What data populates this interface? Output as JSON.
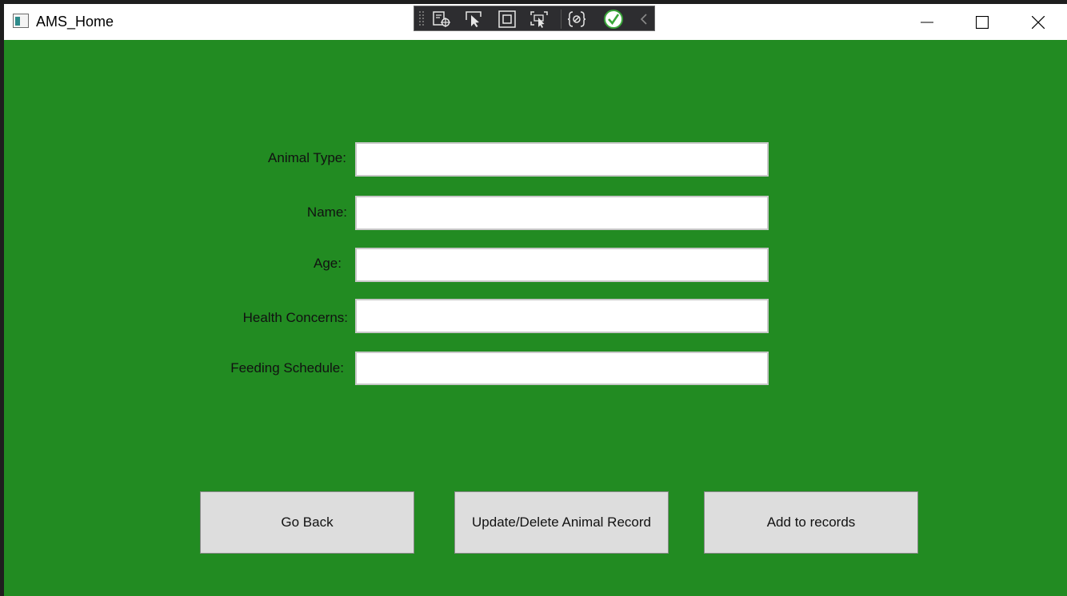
{
  "window": {
    "title": "AMS_Home",
    "background_color": "#228b22"
  },
  "devtools": {
    "icons": [
      "select-element-icon",
      "pointer-select-icon",
      "layout-adorner-icon",
      "track-focus-icon",
      "binding-failures-icon",
      "checkmark-icon",
      "collapse-chevron-icon"
    ]
  },
  "form": {
    "animal_type": {
      "label": "Animal Type:",
      "value": ""
    },
    "name": {
      "label": "Name:",
      "value": ""
    },
    "age": {
      "label": "Age:",
      "value": ""
    },
    "health_concerns": {
      "label": "Health Concerns:",
      "value": ""
    },
    "feeding_schedule": {
      "label": "Feeding Schedule:",
      "value": ""
    }
  },
  "buttons": {
    "go_back": "Go Back",
    "update_delete": "Update/Delete Animal Record",
    "add_to_records": "Add to records"
  }
}
